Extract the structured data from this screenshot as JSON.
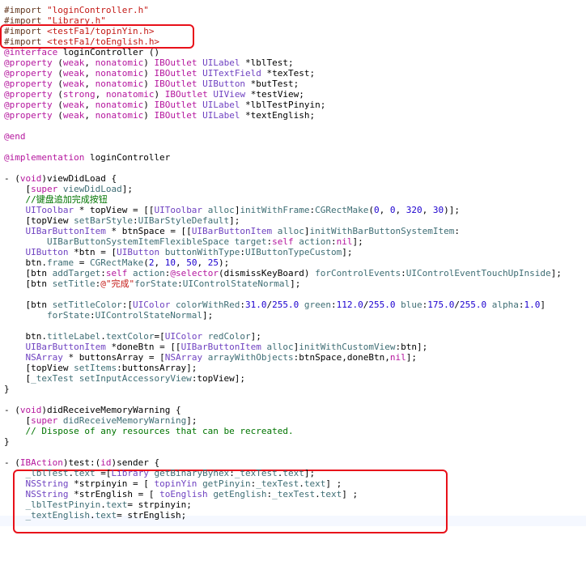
{
  "colors": {
    "keyword": "#b5179e",
    "string": "#c41a16",
    "class": "#6f42c1",
    "call": "#3e6d74",
    "number": "#1c00cf",
    "comment": "#007400",
    "preprocessor": "#643820",
    "highlight_box": "#e8101a"
  },
  "code_lines": [
    [
      [
        "pre",
        "#import "
      ],
      [
        "str",
        "\"loginController.h\""
      ]
    ],
    [
      [
        "pre",
        "#import "
      ],
      [
        "str",
        "\"Library.h\""
      ]
    ],
    [
      [
        "pre",
        "#import "
      ],
      [
        "str",
        "<testFa1/topinYin.h>"
      ]
    ],
    [
      [
        "pre",
        "#import "
      ],
      [
        "str",
        "<testFa1/toEnglish.h>"
      ]
    ],
    [
      [
        "kw",
        "@interface"
      ],
      [
        "plain",
        " loginController ()"
      ]
    ],
    [
      [
        "kw",
        "@property"
      ],
      [
        "plain",
        " ("
      ],
      [
        "kw",
        "weak"
      ],
      [
        "plain",
        ", "
      ],
      [
        "kw",
        "nonatomic"
      ],
      [
        "plain",
        ") "
      ],
      [
        "kw",
        "IBOutlet"
      ],
      [
        "plain",
        " "
      ],
      [
        "cls",
        "UILabel"
      ],
      [
        "plain",
        " *lblTest;"
      ]
    ],
    [
      [
        "kw",
        "@property"
      ],
      [
        "plain",
        " ("
      ],
      [
        "kw",
        "weak"
      ],
      [
        "plain",
        ", "
      ],
      [
        "kw",
        "nonatomic"
      ],
      [
        "plain",
        ") "
      ],
      [
        "kw",
        "IBOutlet"
      ],
      [
        "plain",
        " "
      ],
      [
        "cls",
        "UITextField"
      ],
      [
        "plain",
        " *texTest;"
      ]
    ],
    [
      [
        "kw",
        "@property"
      ],
      [
        "plain",
        " ("
      ],
      [
        "kw",
        "weak"
      ],
      [
        "plain",
        ", "
      ],
      [
        "kw",
        "nonatomic"
      ],
      [
        "plain",
        ") "
      ],
      [
        "kw",
        "IBOutlet"
      ],
      [
        "plain",
        " "
      ],
      [
        "cls",
        "UIButton"
      ],
      [
        "plain",
        " *butTest;"
      ]
    ],
    [
      [
        "kw",
        "@property"
      ],
      [
        "plain",
        " ("
      ],
      [
        "kw",
        "strong"
      ],
      [
        "plain",
        ", "
      ],
      [
        "kw",
        "nonatomic"
      ],
      [
        "plain",
        ") "
      ],
      [
        "kw",
        "IBOutlet"
      ],
      [
        "plain",
        " "
      ],
      [
        "cls",
        "UIView"
      ],
      [
        "plain",
        " *testView;"
      ]
    ],
    [
      [
        "kw",
        "@property"
      ],
      [
        "plain",
        " ("
      ],
      [
        "kw",
        "weak"
      ],
      [
        "plain",
        ", "
      ],
      [
        "kw",
        "nonatomic"
      ],
      [
        "plain",
        ") "
      ],
      [
        "kw",
        "IBOutlet"
      ],
      [
        "plain",
        " "
      ],
      [
        "cls",
        "UILabel"
      ],
      [
        "plain",
        " *lblTestPinyin;"
      ]
    ],
    [
      [
        "kw",
        "@property"
      ],
      [
        "plain",
        " ("
      ],
      [
        "kw",
        "weak"
      ],
      [
        "plain",
        ", "
      ],
      [
        "kw",
        "nonatomic"
      ],
      [
        "plain",
        ") "
      ],
      [
        "kw",
        "IBOutlet"
      ],
      [
        "plain",
        " "
      ],
      [
        "cls",
        "UILabel"
      ],
      [
        "plain",
        " *textEnglish;"
      ]
    ],
    [],
    [
      [
        "kw",
        "@end"
      ]
    ],
    [],
    [
      [
        "kw",
        "@implementation"
      ],
      [
        "plain",
        " loginController"
      ]
    ],
    [],
    [
      [
        "plain",
        "- ("
      ],
      [
        "kw",
        "void"
      ],
      [
        "plain",
        ")viewDidLoad {"
      ]
    ],
    [
      [
        "plain",
        "    ["
      ],
      [
        "kw",
        "super"
      ],
      [
        "plain",
        " "
      ],
      [
        "call",
        "viewDidLoad"
      ],
      [
        "plain",
        "];"
      ]
    ],
    [
      [
        "cmt",
        "    //键盘追加完成按钮"
      ]
    ],
    [
      [
        "plain",
        "    "
      ],
      [
        "cls",
        "UIToolbar"
      ],
      [
        "plain",
        " * topView = [["
      ],
      [
        "cls",
        "UIToolbar"
      ],
      [
        "plain",
        " "
      ],
      [
        "call",
        "alloc"
      ],
      [
        "plain",
        "]"
      ],
      [
        "call",
        "initWithFrame"
      ],
      [
        "plain",
        ":"
      ],
      [
        "call",
        "CGRectMake"
      ],
      [
        "plain",
        "("
      ],
      [
        "num",
        "0"
      ],
      [
        "plain",
        ", "
      ],
      [
        "num",
        "0"
      ],
      [
        "plain",
        ", "
      ],
      [
        "num",
        "320"
      ],
      [
        "plain",
        ", "
      ],
      [
        "num",
        "30"
      ],
      [
        "plain",
        ")];"
      ]
    ],
    [
      [
        "plain",
        "    [topView "
      ],
      [
        "call",
        "setBarStyle"
      ],
      [
        "plain",
        ":"
      ],
      [
        "call",
        "UIBarStyleDefault"
      ],
      [
        "plain",
        "];"
      ]
    ],
    [
      [
        "plain",
        "    "
      ],
      [
        "cls",
        "UIBarButtonItem"
      ],
      [
        "plain",
        " * btnSpace = [["
      ],
      [
        "cls",
        "UIBarButtonItem"
      ],
      [
        "plain",
        " "
      ],
      [
        "call",
        "alloc"
      ],
      [
        "plain",
        "]"
      ],
      [
        "call",
        "initWithBarButtonSystemItem"
      ],
      [
        "plain",
        ":"
      ]
    ],
    [
      [
        "plain",
        "        "
      ],
      [
        "call",
        "UIBarButtonSystemItemFlexibleSpace"
      ],
      [
        "plain",
        " "
      ],
      [
        "call",
        "target"
      ],
      [
        "plain",
        ":"
      ],
      [
        "kw",
        "self"
      ],
      [
        "plain",
        " "
      ],
      [
        "call",
        "action"
      ],
      [
        "plain",
        ":"
      ],
      [
        "kw",
        "nil"
      ],
      [
        "plain",
        "];"
      ]
    ],
    [
      [
        "plain",
        "    "
      ],
      [
        "cls",
        "UIButton"
      ],
      [
        "plain",
        " *btn = ["
      ],
      [
        "cls",
        "UIButton"
      ],
      [
        "plain",
        " "
      ],
      [
        "call",
        "buttonWithType"
      ],
      [
        "plain",
        ":"
      ],
      [
        "call",
        "UIButtonTypeCustom"
      ],
      [
        "plain",
        "];"
      ]
    ],
    [
      [
        "plain",
        "    btn."
      ],
      [
        "call",
        "frame"
      ],
      [
        "plain",
        " = "
      ],
      [
        "call",
        "CGRectMake"
      ],
      [
        "plain",
        "("
      ],
      [
        "num",
        "2"
      ],
      [
        "plain",
        ", "
      ],
      [
        "num",
        "10"
      ],
      [
        "plain",
        ", "
      ],
      [
        "num",
        "50"
      ],
      [
        "plain",
        ", "
      ],
      [
        "num",
        "25"
      ],
      [
        "plain",
        ");"
      ]
    ],
    [
      [
        "plain",
        "    [btn "
      ],
      [
        "call",
        "addTarget"
      ],
      [
        "plain",
        ":"
      ],
      [
        "kw",
        "self"
      ],
      [
        "plain",
        " "
      ],
      [
        "call",
        "action"
      ],
      [
        "plain",
        ":"
      ],
      [
        "kw",
        "@selector"
      ],
      [
        "plain",
        "(dismissKeyBoard) "
      ],
      [
        "call",
        "forControlEvents"
      ],
      [
        "plain",
        ":"
      ],
      [
        "call",
        "UIControlEventTouchUpInside"
      ],
      [
        "plain",
        "];"
      ]
    ],
    [
      [
        "plain",
        "    [btn "
      ],
      [
        "call",
        "setTitle"
      ],
      [
        "plain",
        ":"
      ],
      [
        "str",
        "@\"完成\""
      ],
      [
        "call",
        "forState"
      ],
      [
        "plain",
        ":"
      ],
      [
        "call",
        "UIControlStateNormal"
      ],
      [
        "plain",
        "];"
      ]
    ],
    [],
    [
      [
        "plain",
        "    [btn "
      ],
      [
        "call",
        "setTitleColor"
      ],
      [
        "plain",
        ":["
      ],
      [
        "cls",
        "UIColor"
      ],
      [
        "plain",
        " "
      ],
      [
        "call",
        "colorWithRed"
      ],
      [
        "plain",
        ":"
      ],
      [
        "num",
        "31.0"
      ],
      [
        "plain",
        "/"
      ],
      [
        "num",
        "255.0"
      ],
      [
        "plain",
        " "
      ],
      [
        "call",
        "green"
      ],
      [
        "plain",
        ":"
      ],
      [
        "num",
        "112.0"
      ],
      [
        "plain",
        "/"
      ],
      [
        "num",
        "255.0"
      ],
      [
        "plain",
        " "
      ],
      [
        "call",
        "blue"
      ],
      [
        "plain",
        ":"
      ],
      [
        "num",
        "175.0"
      ],
      [
        "plain",
        "/"
      ],
      [
        "num",
        "255.0"
      ],
      [
        "plain",
        " "
      ],
      [
        "call",
        "alpha"
      ],
      [
        "plain",
        ":"
      ],
      [
        "num",
        "1.0"
      ],
      [
        "plain",
        "]"
      ]
    ],
    [
      [
        "plain",
        "        "
      ],
      [
        "call",
        "forState"
      ],
      [
        "plain",
        ":"
      ],
      [
        "call",
        "UIControlStateNormal"
      ],
      [
        "plain",
        "];"
      ]
    ],
    [],
    [
      [
        "plain",
        "    btn."
      ],
      [
        "call",
        "titleLabel"
      ],
      [
        "plain",
        "."
      ],
      [
        "call",
        "textColor"
      ],
      [
        "plain",
        "=["
      ],
      [
        "cls",
        "UIColor"
      ],
      [
        "plain",
        " "
      ],
      [
        "call",
        "redColor"
      ],
      [
        "plain",
        "];"
      ]
    ],
    [
      [
        "plain",
        "    "
      ],
      [
        "cls",
        "UIBarButtonItem"
      ],
      [
        "plain",
        " *doneBtn = [["
      ],
      [
        "cls",
        "UIBarButtonItem"
      ],
      [
        "plain",
        " "
      ],
      [
        "call",
        "alloc"
      ],
      [
        "plain",
        "]"
      ],
      [
        "call",
        "initWithCustomView"
      ],
      [
        "plain",
        ":btn];"
      ]
    ],
    [
      [
        "plain",
        "    "
      ],
      [
        "cls",
        "NSArray"
      ],
      [
        "plain",
        " * buttonsArray = ["
      ],
      [
        "cls",
        "NSArray"
      ],
      [
        "plain",
        " "
      ],
      [
        "call",
        "arrayWithObjects"
      ],
      [
        "plain",
        ":btnSpace,doneBtn,"
      ],
      [
        "kw",
        "nil"
      ],
      [
        "plain",
        "];"
      ]
    ],
    [
      [
        "plain",
        "    [topView "
      ],
      [
        "call",
        "setItems"
      ],
      [
        "plain",
        ":buttonsArray];"
      ]
    ],
    [
      [
        "plain",
        "    ["
      ],
      [
        "call",
        "_texTest"
      ],
      [
        "plain",
        " "
      ],
      [
        "call",
        "setInputAccessoryView"
      ],
      [
        "plain",
        ":topView];"
      ]
    ],
    [
      [
        "plain",
        "}"
      ]
    ],
    [],
    [
      [
        "plain",
        "- ("
      ],
      [
        "kw",
        "void"
      ],
      [
        "plain",
        ")didReceiveMemoryWarning {"
      ]
    ],
    [
      [
        "plain",
        "    ["
      ],
      [
        "kw",
        "super"
      ],
      [
        "plain",
        " "
      ],
      [
        "call",
        "didReceiveMemoryWarning"
      ],
      [
        "plain",
        "];"
      ]
    ],
    [
      [
        "cmt",
        "    // Dispose of any resources that can be recreated."
      ]
    ],
    [
      [
        "plain",
        "}"
      ]
    ],
    [],
    [
      [
        "plain",
        "- ("
      ],
      [
        "kw",
        "IBAction"
      ],
      [
        "plain",
        ")test:("
      ],
      [
        "kw",
        "id"
      ],
      [
        "plain",
        ")sender {"
      ]
    ],
    [
      [
        "plain",
        "    "
      ],
      [
        "call",
        "_lblTest"
      ],
      [
        "plain",
        "."
      ],
      [
        "call",
        "text"
      ],
      [
        "plain",
        " =["
      ],
      [
        "cls",
        "Library"
      ],
      [
        "plain",
        " "
      ],
      [
        "call",
        "getBinaryByhex"
      ],
      [
        "plain",
        ":"
      ],
      [
        "call",
        "_texTest"
      ],
      [
        "plain",
        "."
      ],
      [
        "call",
        "text"
      ],
      [
        "plain",
        "];"
      ]
    ],
    [
      [
        "plain",
        "    "
      ],
      [
        "cls",
        "NSString"
      ],
      [
        "plain",
        " *strpinyin = [ "
      ],
      [
        "cls",
        "topinYin"
      ],
      [
        "plain",
        " "
      ],
      [
        "call",
        "getPinyin"
      ],
      [
        "plain",
        ":"
      ],
      [
        "call",
        "_texTest"
      ],
      [
        "plain",
        "."
      ],
      [
        "call",
        "text"
      ],
      [
        "plain",
        "] ;"
      ]
    ],
    [
      [
        "plain",
        "    "
      ],
      [
        "cls",
        "NSString"
      ],
      [
        "plain",
        " *strEnglish = [ "
      ],
      [
        "cls",
        "toEnglish"
      ],
      [
        "plain",
        " "
      ],
      [
        "call",
        "getEnglish"
      ],
      [
        "plain",
        ":"
      ],
      [
        "call",
        "_texTest"
      ],
      [
        "plain",
        "."
      ],
      [
        "call",
        "text"
      ],
      [
        "plain",
        "] ;"
      ]
    ],
    [
      [
        "plain",
        "    "
      ],
      [
        "call",
        "_lblTestPinyin"
      ],
      [
        "plain",
        "."
      ],
      [
        "call",
        "text"
      ],
      [
        "plain",
        "= strpinyin;"
      ]
    ],
    [
      [
        "plain",
        "    "
      ],
      [
        "call",
        "_textEnglish"
      ],
      [
        "plain",
        "."
      ],
      [
        "call",
        "text"
      ],
      [
        "plain",
        "= strEnglish;"
      ]
    ]
  ]
}
